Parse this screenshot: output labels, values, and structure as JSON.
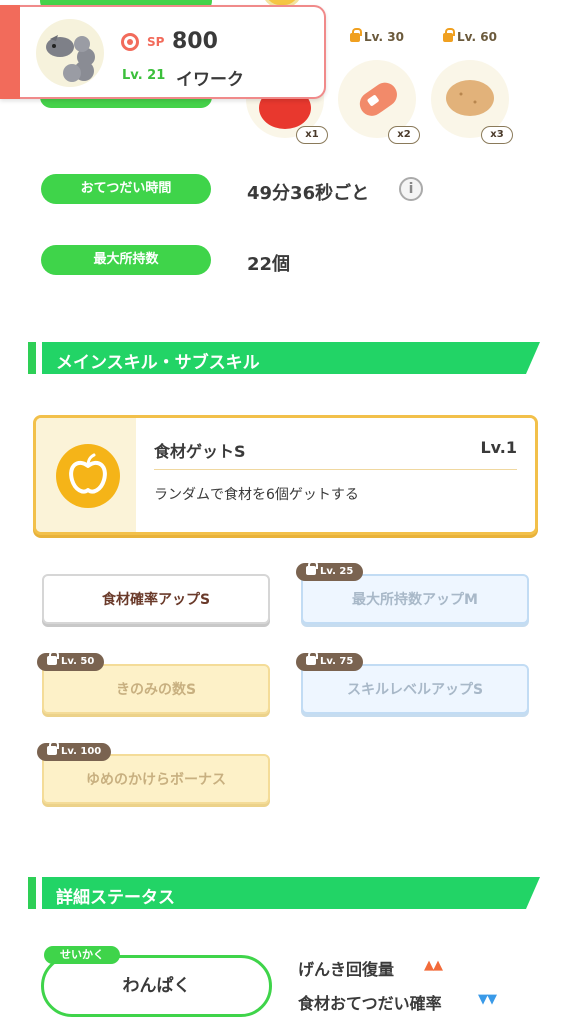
{
  "pokemon_card": {
    "sp_label": "SP",
    "sp_value": "800",
    "level": "Lv. 21",
    "name": "イワーク"
  },
  "ingredients": [
    {
      "food_icon": "tomato-icon",
      "unlock_level": "",
      "quantity": "x1"
    },
    {
      "food_icon": "sausage-icon",
      "unlock_level": "Lv. 30",
      "quantity": "x2"
    },
    {
      "food_icon": "potato-icon",
      "unlock_level": "Lv. 60",
      "quantity": "x3"
    }
  ],
  "stats": {
    "help_time_label": "おてつだい時間",
    "help_time_value": "49分36秒ごと",
    "max_carry_label": "最大所持数",
    "max_carry_value": "22個"
  },
  "skills_section": {
    "title": "メインスキル・サブスキル",
    "main_skill": {
      "name": "食材ゲットS",
      "level": "Lv.1",
      "description": "ランダムで食材を6個ゲットする",
      "icon": "apple-icon"
    },
    "sub_skills": [
      {
        "label": "食材確率アップS",
        "lock": "",
        "color": "#6a3a2a"
      },
      {
        "label": "最大所持数アップM",
        "lock": "Lv. 25",
        "color": "#a8b8c8"
      },
      {
        "label": "きのみの数S",
        "lock": "Lv. 50",
        "color": "#c8b080"
      },
      {
        "label": "スキルレベルアップS",
        "lock": "Lv. 75",
        "color": "#a8b8c8"
      },
      {
        "label": "ゆめのかけらボーナス",
        "lock": "Lv. 100",
        "color": "#c8b080"
      }
    ]
  },
  "details_section": {
    "title": "詳細ステータス",
    "nature_tag": "せいかく",
    "nature": "わんぱく",
    "up_effect": "げんき回復量",
    "up_arrows": "▲▲",
    "down_effect": "食材おてつだい確率",
    "down_arrows": "▼▼"
  },
  "colors": {
    "accent_green": "#22d466",
    "sp_red": "#f26b5b",
    "skill_gold": "#f2c04a"
  }
}
